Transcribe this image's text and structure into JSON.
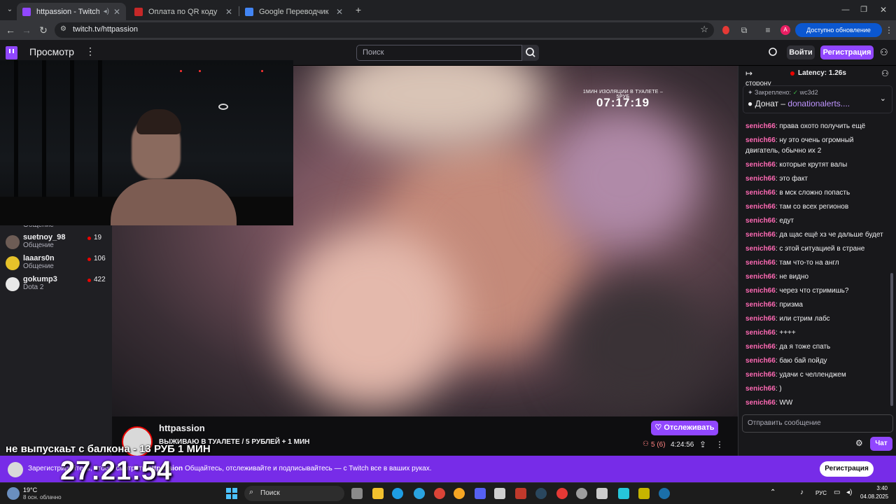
{
  "browser": {
    "tabs": [
      {
        "title": "httpassion - Twitch",
        "active": true
      },
      {
        "title": "Оплата по QR коду",
        "active": false
      },
      {
        "title": "Google Переводчик",
        "active": false
      }
    ],
    "url": "twitch.tv/httpassion",
    "update_label": "Доступно обновление Chrome",
    "profile_initial": "A"
  },
  "twitch": {
    "browse_label": "Просмотр",
    "search_placeholder": "Поиск",
    "login_label": "Войти",
    "signup_label": "Регистрация"
  },
  "sidebar": {
    "partial_label": "Общение",
    "channels": [
      {
        "name": "suetnoy_98",
        "game": "Общение",
        "viewers": "19"
      },
      {
        "name": "laaars0n",
        "game": "Общение",
        "viewers": "106"
      },
      {
        "name": "gokump3",
        "game": "Dota 2",
        "viewers": "422"
      }
    ]
  },
  "player": {
    "overlay_title": "1МИН ИЗОЛЯЦИИ В ТУАЛЕТЕ – 5РУБ",
    "overlay_timer": "07:17:19"
  },
  "stream": {
    "streamer": "httpassion",
    "title": "ВЫЖИВАЮ В ТУАЛЕТЕ / 5 РУБЛЕЙ + 1 МИН",
    "follow_label": "Отслеживать",
    "viewers": "5 (6)",
    "uptime": "4:24:56"
  },
  "chat": {
    "latency": "Latency: 1.26s",
    "partial_top": "сторону",
    "pinned_by": "Закреплено:",
    "pinned_user": "wc3d2",
    "pinned_prefix": "Донат – ",
    "pinned_link": "donationalerts....",
    "messages": [
      {
        "user": "senich66",
        "text": "права охото получить ещё"
      },
      {
        "user": "senich66",
        "text": "ну это очень огромный двигатель, обычно их 2"
      },
      {
        "user": "senich66",
        "text": "которые крутят валы"
      },
      {
        "user": "senich66",
        "text": "это факт"
      },
      {
        "user": "senich66",
        "text": "в мск сложно попасть"
      },
      {
        "user": "senich66",
        "text": "там со всех регионов"
      },
      {
        "user": "senich66",
        "text": "едут"
      },
      {
        "user": "senich66",
        "text": "да щас ещё хз че дальше будет"
      },
      {
        "user": "senich66",
        "text": "с этой ситуацией в стране"
      },
      {
        "user": "senich66",
        "text": "там что-то на англ"
      },
      {
        "user": "senich66",
        "text": "не видно"
      },
      {
        "user": "senich66",
        "text": "через что стримишь?"
      },
      {
        "user": "senich66",
        "text": "призма"
      },
      {
        "user": "senich66",
        "text": "или стрим лабс"
      },
      {
        "user": "senich66",
        "text": "++++"
      },
      {
        "user": "senich66",
        "text": "да я тоже спать"
      },
      {
        "user": "senich66",
        "text": "баю бай пойду"
      },
      {
        "user": "senich66",
        "text": "удачи с челленджем"
      },
      {
        "user": "senich66",
        "text": ")"
      },
      {
        "user": "senich66",
        "text": "WW"
      }
    ],
    "input_placeholder": "Отправить сообщение",
    "send_label": "Чат"
  },
  "banner": {
    "text_prefix": "Зарегистрируйтесь, чтобы смотреть",
    "channel": "httpassion",
    "text_suffix": "Общайтесь, отслеживайте и подписывайтесь — с Twitch все в ваших руках.",
    "button_label": "Регистрация"
  },
  "overlay": {
    "caption": "не выпускаьт с балкона - 13 РУБ 1 МИН",
    "timer": "27:21:54"
  },
  "taskbar": {
    "temp": "19°C",
    "weather": "8 осн. облачно",
    "search": "Поиск",
    "lang": "РУС",
    "time": "3:40",
    "date": "04.08.2025"
  },
  "colors": {
    "twitch_purple": "#9147ff",
    "banner_purple": "#772ce8",
    "chat_user": "#ff69b4",
    "live_red": "#eb0400"
  }
}
